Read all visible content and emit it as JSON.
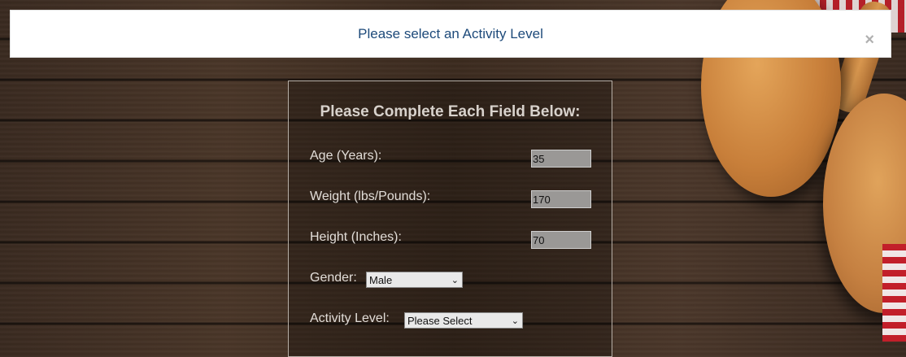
{
  "alert": {
    "message": "Please select an Activity Level",
    "close_glyph": "×"
  },
  "form": {
    "title": "Please Complete Each Field Below:",
    "age": {
      "label": "Age (Years):",
      "value": "35"
    },
    "weight": {
      "label": "Weight (lbs/Pounds):",
      "value": "170"
    },
    "height": {
      "label": "Height (Inches):",
      "value": "70"
    },
    "gender": {
      "label": "Gender:",
      "selected": "Male"
    },
    "activity": {
      "label": "Activity Level:",
      "selected": "Please Select"
    }
  },
  "colors": {
    "alert_text": "#1d4a7a",
    "background_wood": "#3c2b1f"
  }
}
